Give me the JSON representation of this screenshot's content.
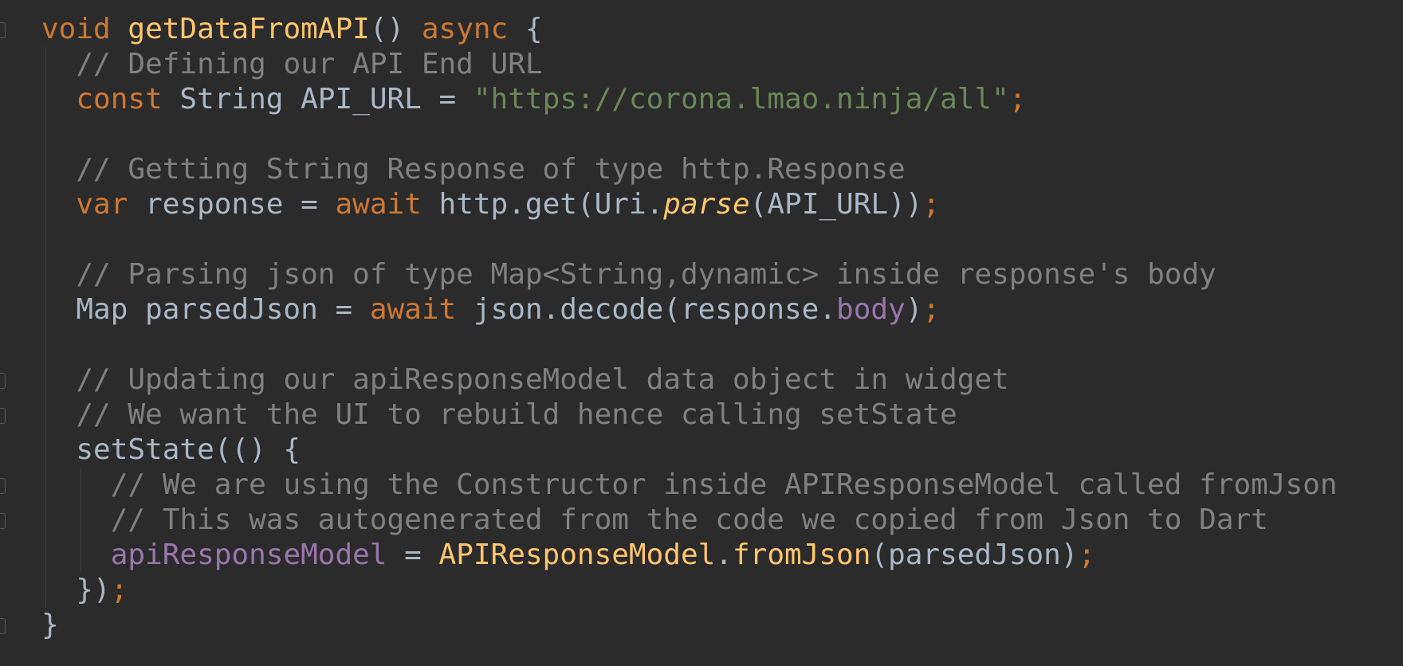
{
  "lines": [
    [
      {
        "t": "void",
        "c": "kw"
      },
      {
        "t": " "
      },
      {
        "t": "getDataFromAPI",
        "c": "fn"
      },
      {
        "t": "() "
      },
      {
        "t": "async",
        "c": "kw"
      },
      {
        "t": " {"
      }
    ],
    [
      {
        "t": "  "
      },
      {
        "t": "// Defining our API End URL",
        "c": "cm"
      }
    ],
    [
      {
        "t": "  "
      },
      {
        "t": "const",
        "c": "kw"
      },
      {
        "t": " String API_URL = "
      },
      {
        "t": "\"https://corona.lmao.ninja/all\"",
        "c": "str"
      },
      {
        "t": ";",
        "c": "semi"
      }
    ],
    [
      {
        "t": ""
      }
    ],
    [
      {
        "t": "  "
      },
      {
        "t": "// Getting String Response of type http.Response",
        "c": "cm"
      }
    ],
    [
      {
        "t": "  "
      },
      {
        "t": "var",
        "c": "kw"
      },
      {
        "t": " response = "
      },
      {
        "t": "await",
        "c": "kw"
      },
      {
        "t": " http.get(Uri."
      },
      {
        "t": "parse",
        "c": "it"
      },
      {
        "t": "(API_URL))"
      },
      {
        "t": ";",
        "c": "semi"
      }
    ],
    [
      {
        "t": ""
      }
    ],
    [
      {
        "t": "  "
      },
      {
        "t": "// Parsing json of type Map<String,dynamic> inside response's body",
        "c": "cm"
      }
    ],
    [
      {
        "t": "  Map parsedJson = "
      },
      {
        "t": "await",
        "c": "kw"
      },
      {
        "t": " json.decode(response."
      },
      {
        "t": "body",
        "c": "fld"
      },
      {
        "t": ")"
      },
      {
        "t": ";",
        "c": "semi"
      }
    ],
    [
      {
        "t": ""
      }
    ],
    [
      {
        "t": "  "
      },
      {
        "t": "// Updating our apiResponseModel data object in widget",
        "c": "cm"
      }
    ],
    [
      {
        "t": "  "
      },
      {
        "t": "// We want the UI to rebuild hence calling setState",
        "c": "cm"
      }
    ],
    [
      {
        "t": "  setState(() {"
      }
    ],
    [
      {
        "t": "    "
      },
      {
        "t": "// We are using the Constructor inside APIResponseModel called fromJson",
        "c": "cm"
      }
    ],
    [
      {
        "t": "    "
      },
      {
        "t": "// This was autogenerated from the code we copied from Json to Dart",
        "c": "cm"
      }
    ],
    [
      {
        "t": "    "
      },
      {
        "t": "apiResponseModel",
        "c": "fld"
      },
      {
        "t": " = "
      },
      {
        "t": "APIResponseModel",
        "c": "fn"
      },
      {
        "t": "."
      },
      {
        "t": "fromJson",
        "c": "fn"
      },
      {
        "t": "(parsedJson)"
      },
      {
        "t": ";",
        "c": "semi"
      }
    ],
    [
      {
        "t": "  })"
      },
      {
        "t": ";",
        "c": "semi"
      }
    ],
    [
      {
        "t": "}"
      }
    ]
  ],
  "colors": {
    "background": "#2b2b2b",
    "keyword": "#cc7832",
    "function": "#ffc66d",
    "string": "#6a8759",
    "comment": "#808080",
    "field": "#9876aa",
    "text": "#a9b7c6"
  }
}
